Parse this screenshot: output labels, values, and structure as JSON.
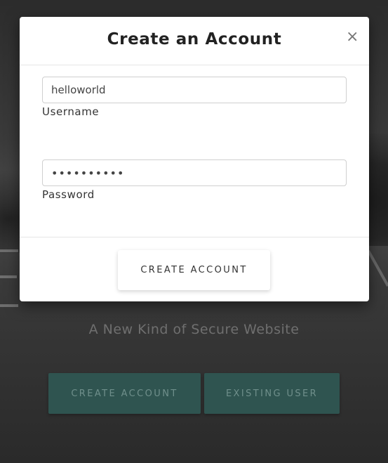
{
  "background": {
    "tagline": "A New Kind of Secure Website",
    "buttons": {
      "create_label": "CREATE ACCOUNT",
      "existing_label": "EXISTING USER"
    },
    "button_color": "#2f5450"
  },
  "modal": {
    "title": "Create an Account",
    "close_glyph": "×",
    "username": {
      "value": "helloworld",
      "label": "Username"
    },
    "password": {
      "value": "••••••••••",
      "label": "Password"
    },
    "submit_label": "CREATE ACCOUNT"
  }
}
